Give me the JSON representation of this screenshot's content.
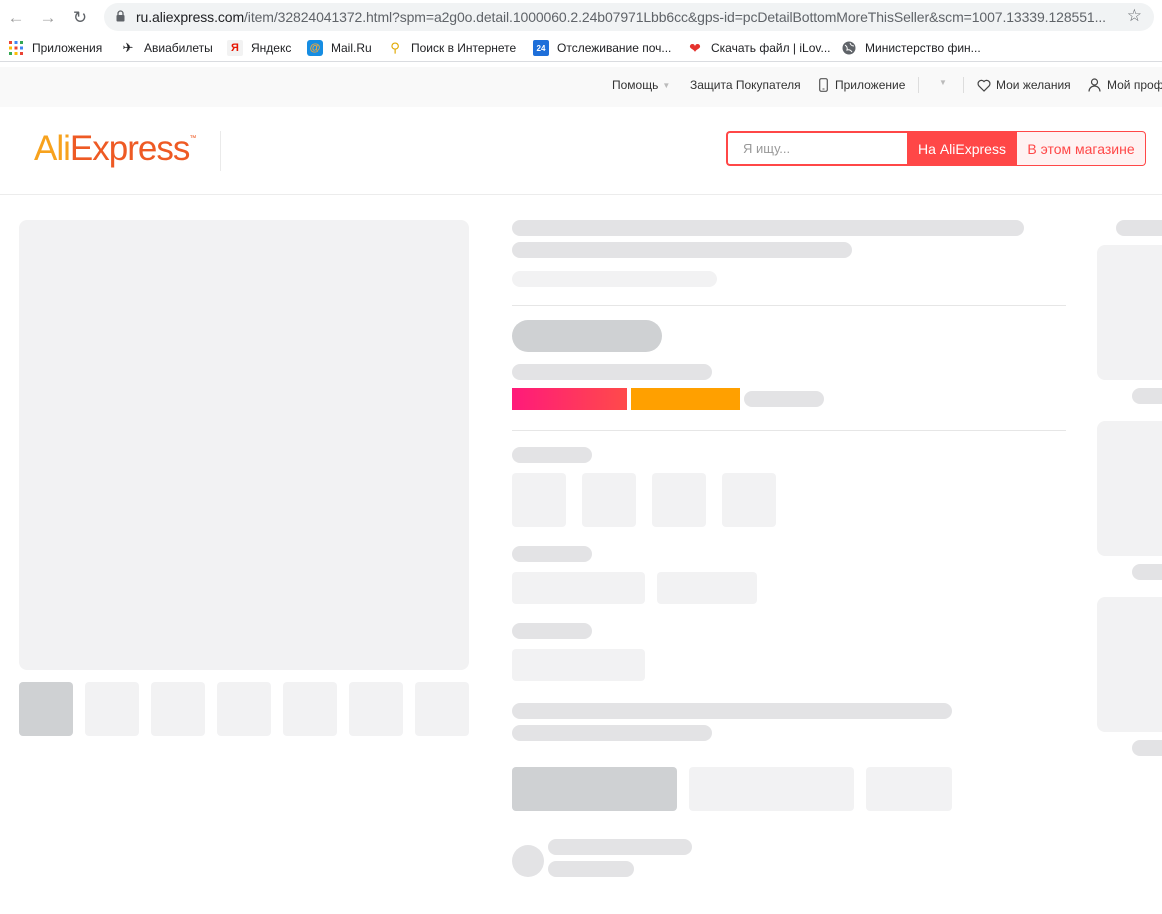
{
  "browser": {
    "url_host": "ru.aliexpress.com",
    "url_path": "/item/32824041372.html?spm=a2g0o.detail.1000060.2.24b07971Lbb6cc&gps-id=pcDetailBottomMoreThisSeller&scm=1007.13339.128551...",
    "back_icon": "arrow-left",
    "forward_icon": "arrow-right",
    "reload_icon": "reload",
    "star_icon": "star",
    "bookmarks": [
      {
        "label": "Приложения",
        "icon": "apps-grid"
      },
      {
        "label": "Авиабилеты",
        "icon": "plane"
      },
      {
        "label": "Яндекс",
        "icon": "yandex"
      },
      {
        "label": "Mail.Ru",
        "icon": "mailru-at"
      },
      {
        "label": "Поиск в Интернете",
        "icon": "search-key"
      },
      {
        "label": "Отслеживание поч...",
        "icon": "24-tracking"
      },
      {
        "label": "Скачать файл | iLov...",
        "icon": "heart"
      },
      {
        "label": "Министерство фин...",
        "icon": "globe"
      }
    ]
  },
  "topnav": {
    "help": "Помощь",
    "buyer_protection": "Защита Покупателя",
    "app": "Приложение",
    "wishlist": "Мои желания",
    "profile": "Мой проф"
  },
  "header": {
    "logo_part1": "Ali",
    "logo_part2": "Express",
    "logo_tm": "™",
    "search_placeholder": "Я ищу...",
    "search_all_label": "На AliExpress",
    "search_store_label": "В этом магазине"
  },
  "colors": {
    "accent": "#ff4747",
    "logo_orange": "#f7a21d",
    "logo_red": "#ee5a24",
    "promo_pink": "#ff1a7a",
    "promo_orange": "#ffa000"
  }
}
